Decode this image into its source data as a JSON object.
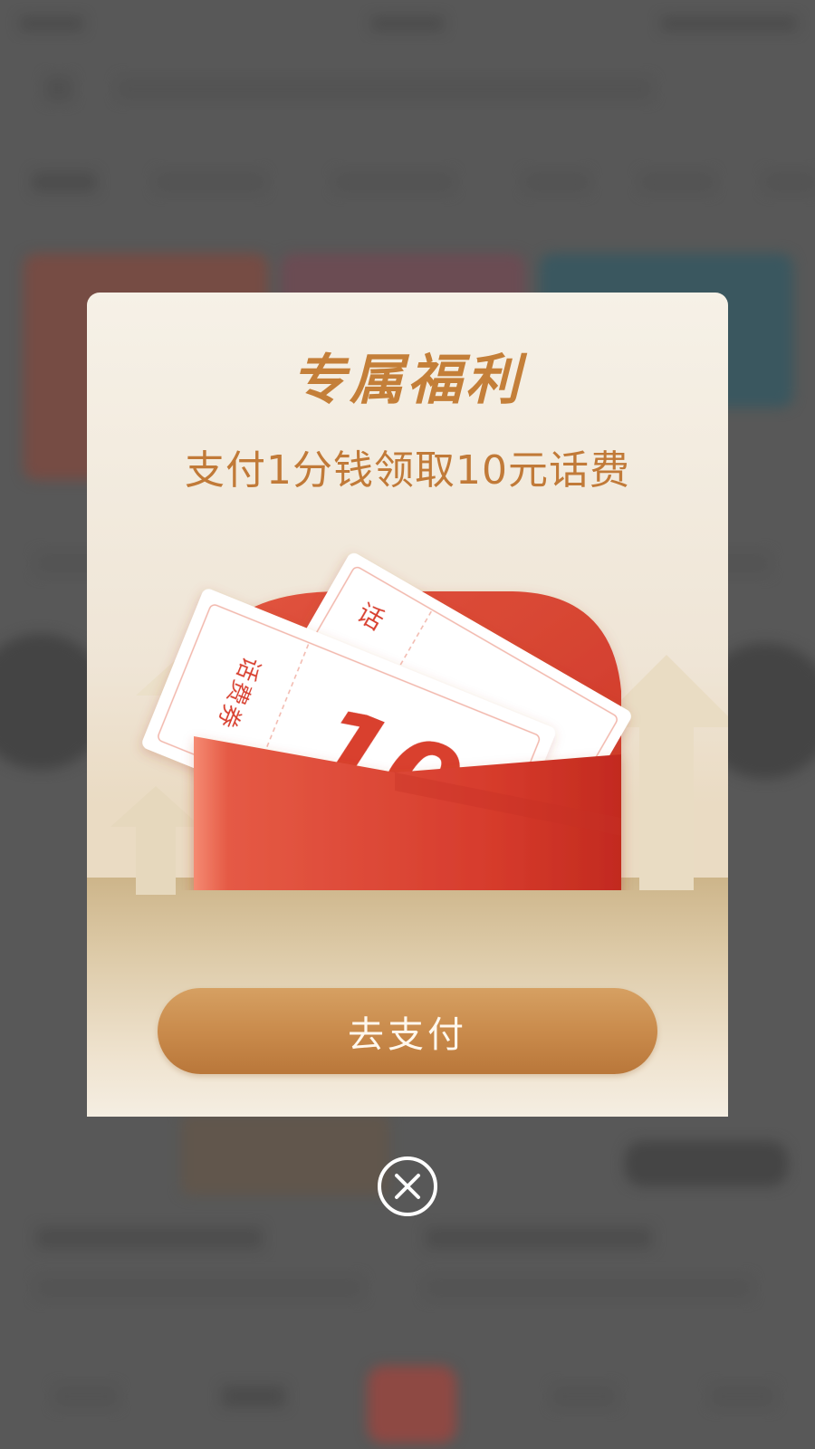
{
  "popup": {
    "title": "专属福利",
    "subtitle": "支付1分钱领取10元话费",
    "voucher": {
      "label": "话费券",
      "back_label": "话",
      "amount": "10"
    },
    "pay_button": "去支付",
    "close_icon": "close-circle-icon"
  },
  "colors": {
    "title": "#c47f39",
    "button": "#c8894a",
    "envelope": "#d9402f",
    "overlay": "#5c5c5c"
  }
}
